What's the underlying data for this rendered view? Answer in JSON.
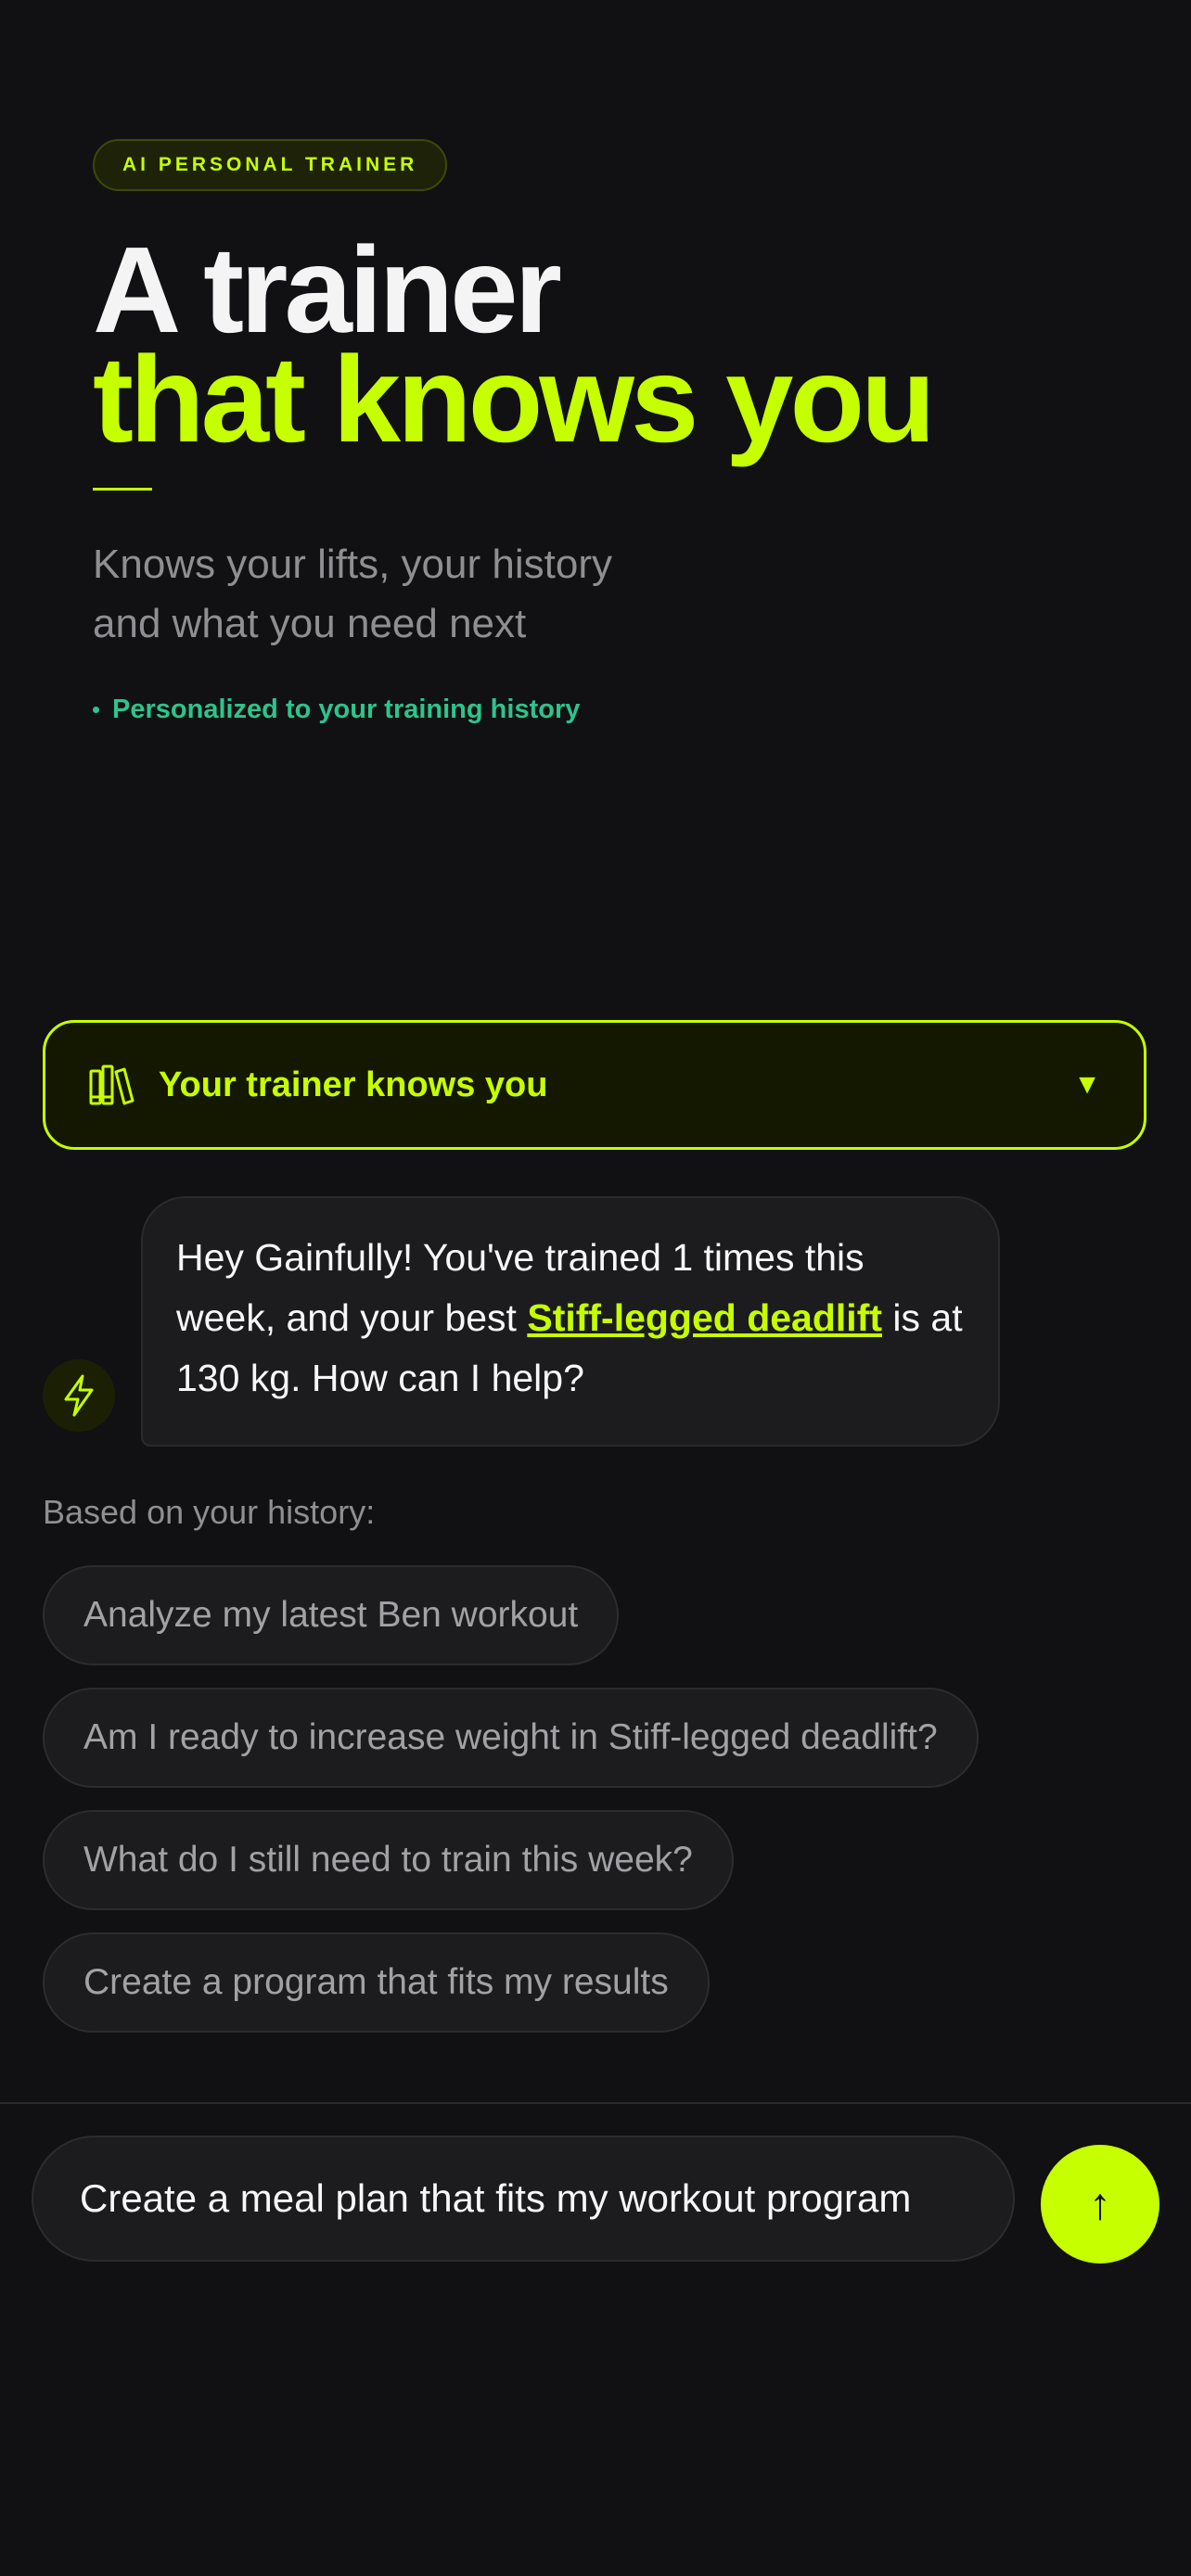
{
  "hero": {
    "badge": "AI PERSONAL TRAINER",
    "title_line1": "A trainer",
    "title_line2": "that knows you",
    "subtitle": "Knows your lifts, your history\nand what you need next",
    "tag": "Personalized to your training history"
  },
  "accordion": {
    "icon": "books-icon",
    "label": "Your trainer knows you",
    "chevron": "▼"
  },
  "message": {
    "avatar_icon": "lightning-icon",
    "text_before": "Hey Gainfully! You've trained 1 times this week, and your best ",
    "link": "Stiff-legged deadlift",
    "text_after": " is at 130 kg. How can I help?"
  },
  "suggestions": {
    "hint": "Based on your history:",
    "items": [
      "Analyze my latest Ben workout",
      "Am I ready to increase weight in Stiff-legged deadlift?",
      "What do I still need to train this week?",
      "Create a program that fits my results"
    ]
  },
  "composer": {
    "value": "Create a meal plan that fits my workout program",
    "send_icon": "↑"
  },
  "colors": {
    "background": "#111113",
    "accent": "#c6ff00",
    "tag_green": "#2dc48d",
    "muted": "#8e8e93"
  }
}
